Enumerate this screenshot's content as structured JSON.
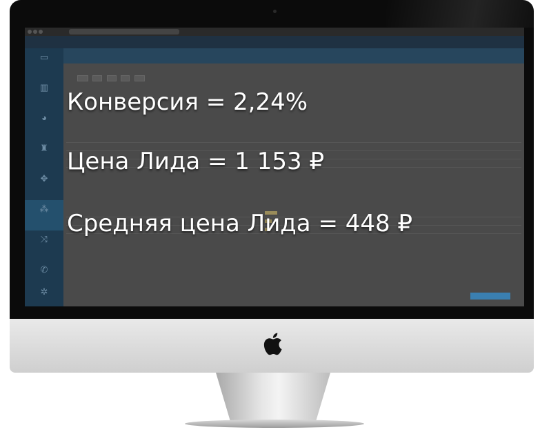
{
  "overlay": {
    "conversion": "Конверсия = 2,24%",
    "lead_price": "Цена Лида = 1 153 ₽",
    "avg_lead_price": "Средняя цена Лида = 448 ₽"
  },
  "colors": {
    "screen_dim": "#3a3a3a",
    "sidebar": "#1d3a50",
    "overlay_text": "#ffffff",
    "accent_button": "#3a7fb0"
  },
  "icons": [
    "apple-logo-icon",
    "dashboard-icon",
    "chart-icon",
    "pie-icon",
    "funnel-icon",
    "flow-icon",
    "phone-icon",
    "settings-icon"
  ]
}
